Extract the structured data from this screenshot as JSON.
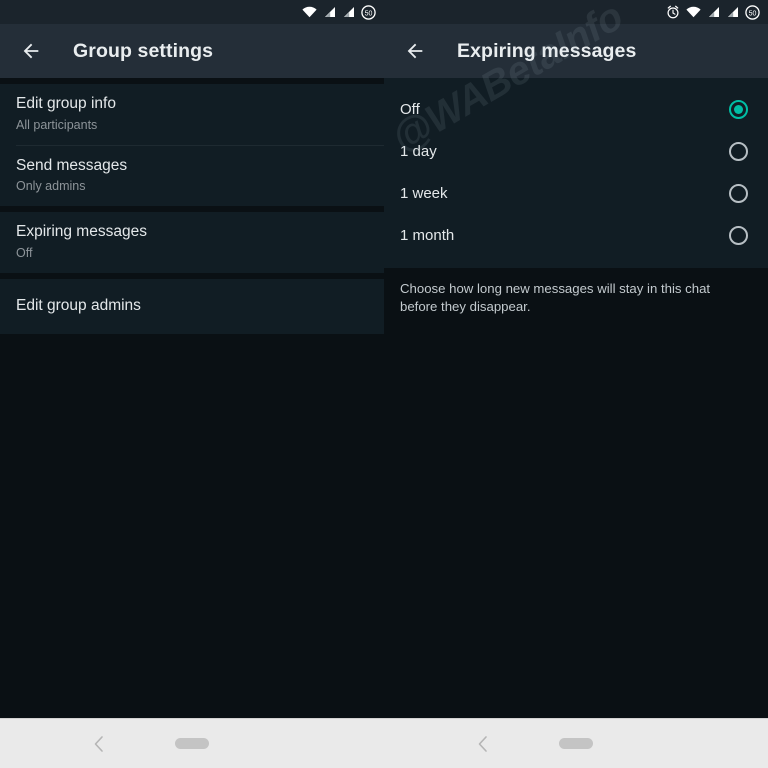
{
  "theme": {
    "accent": "#00bfa5",
    "appbar_bg": "#242e38",
    "card_bg": "#111d24",
    "page_bg": "#0a1014",
    "text_primary": "#e4e8ea",
    "text_secondary": "#8d9499",
    "navbar_bg": "#eaeaea"
  },
  "left_panel": {
    "status_bar": {
      "icons": [
        "wifi-icon",
        "signal-icon",
        "signal-icon",
        "battery-icon"
      ],
      "battery_level": "50"
    },
    "appbar": {
      "back_icon": "arrow-back-icon",
      "title": "Group settings"
    },
    "groups": [
      {
        "rows": [
          {
            "title": "Edit group info",
            "subtitle": "All participants"
          },
          {
            "title": "Send messages",
            "subtitle": "Only admins"
          }
        ]
      },
      {
        "rows": [
          {
            "title": "Expiring messages",
            "subtitle": "Off"
          }
        ]
      },
      {
        "rows": [
          {
            "title": "Edit group admins",
            "subtitle": ""
          }
        ]
      }
    ],
    "watermark": "@WABetaInfo"
  },
  "right_panel": {
    "status_bar": {
      "icons": [
        "alarm-icon",
        "wifi-icon",
        "signal-icon",
        "signal-icon",
        "battery-icon"
      ],
      "battery_level": "50"
    },
    "appbar": {
      "back_icon": "arrow-back-icon",
      "title": "Expiring messages"
    },
    "options": [
      {
        "label": "Off",
        "selected": true
      },
      {
        "label": "1 day",
        "selected": false
      },
      {
        "label": "1 week",
        "selected": false
      },
      {
        "label": "1 month",
        "selected": false
      }
    ],
    "description": "Choose how long new messages will stay in this chat before they disappear.",
    "watermark": "@WABetaInfo"
  },
  "nav_bar": {
    "back_icon": "chevron-back-icon",
    "home_indicator": "home-pill-indicator"
  }
}
